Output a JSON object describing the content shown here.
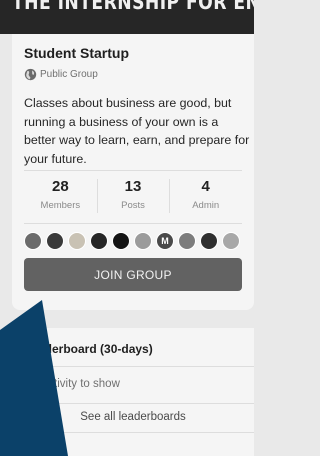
{
  "banner": {
    "text": "THE INTERNSHIP FOR ENTREPRENEURS"
  },
  "group": {
    "name": "Student Startup",
    "type_label": "Public Group",
    "type_icon": "globe-icon",
    "description": "Classes about business are good, but running a business of your own is a better way to learn, earn, and prepare for your future."
  },
  "stats": [
    {
      "value": "28",
      "label": "Members"
    },
    {
      "value": "13",
      "label": "Posts"
    },
    {
      "value": "4",
      "label": "Admin"
    }
  ],
  "avatars": [
    {
      "color": "#6b6b6b",
      "initial": ""
    },
    {
      "color": "#3a3a3a",
      "initial": ""
    },
    {
      "color": "#c9c2b4",
      "initial": ""
    },
    {
      "color": "#262626",
      "initial": ""
    },
    {
      "color": "#141414",
      "initial": ""
    },
    {
      "color": "#9b9b9b",
      "initial": ""
    },
    {
      "color": "#4a4a4a",
      "initial": "M"
    },
    {
      "color": "#7c7c7c",
      "initial": ""
    },
    {
      "color": "#2f2f2f",
      "initial": ""
    },
    {
      "color": "#a8a8a8",
      "initial": ""
    }
  ],
  "join_button": {
    "label": "JOIN GROUP"
  },
  "leaderboard": {
    "title": "Leaderboard (30-days)",
    "empty_text": "No activity to show",
    "see_all_label": "See all leaderboards"
  },
  "colors": {
    "banner": "#262626",
    "card": "#f5f5f5",
    "button": "#626262",
    "shape": "#0b4169",
    "page": "#e9e9e9"
  }
}
